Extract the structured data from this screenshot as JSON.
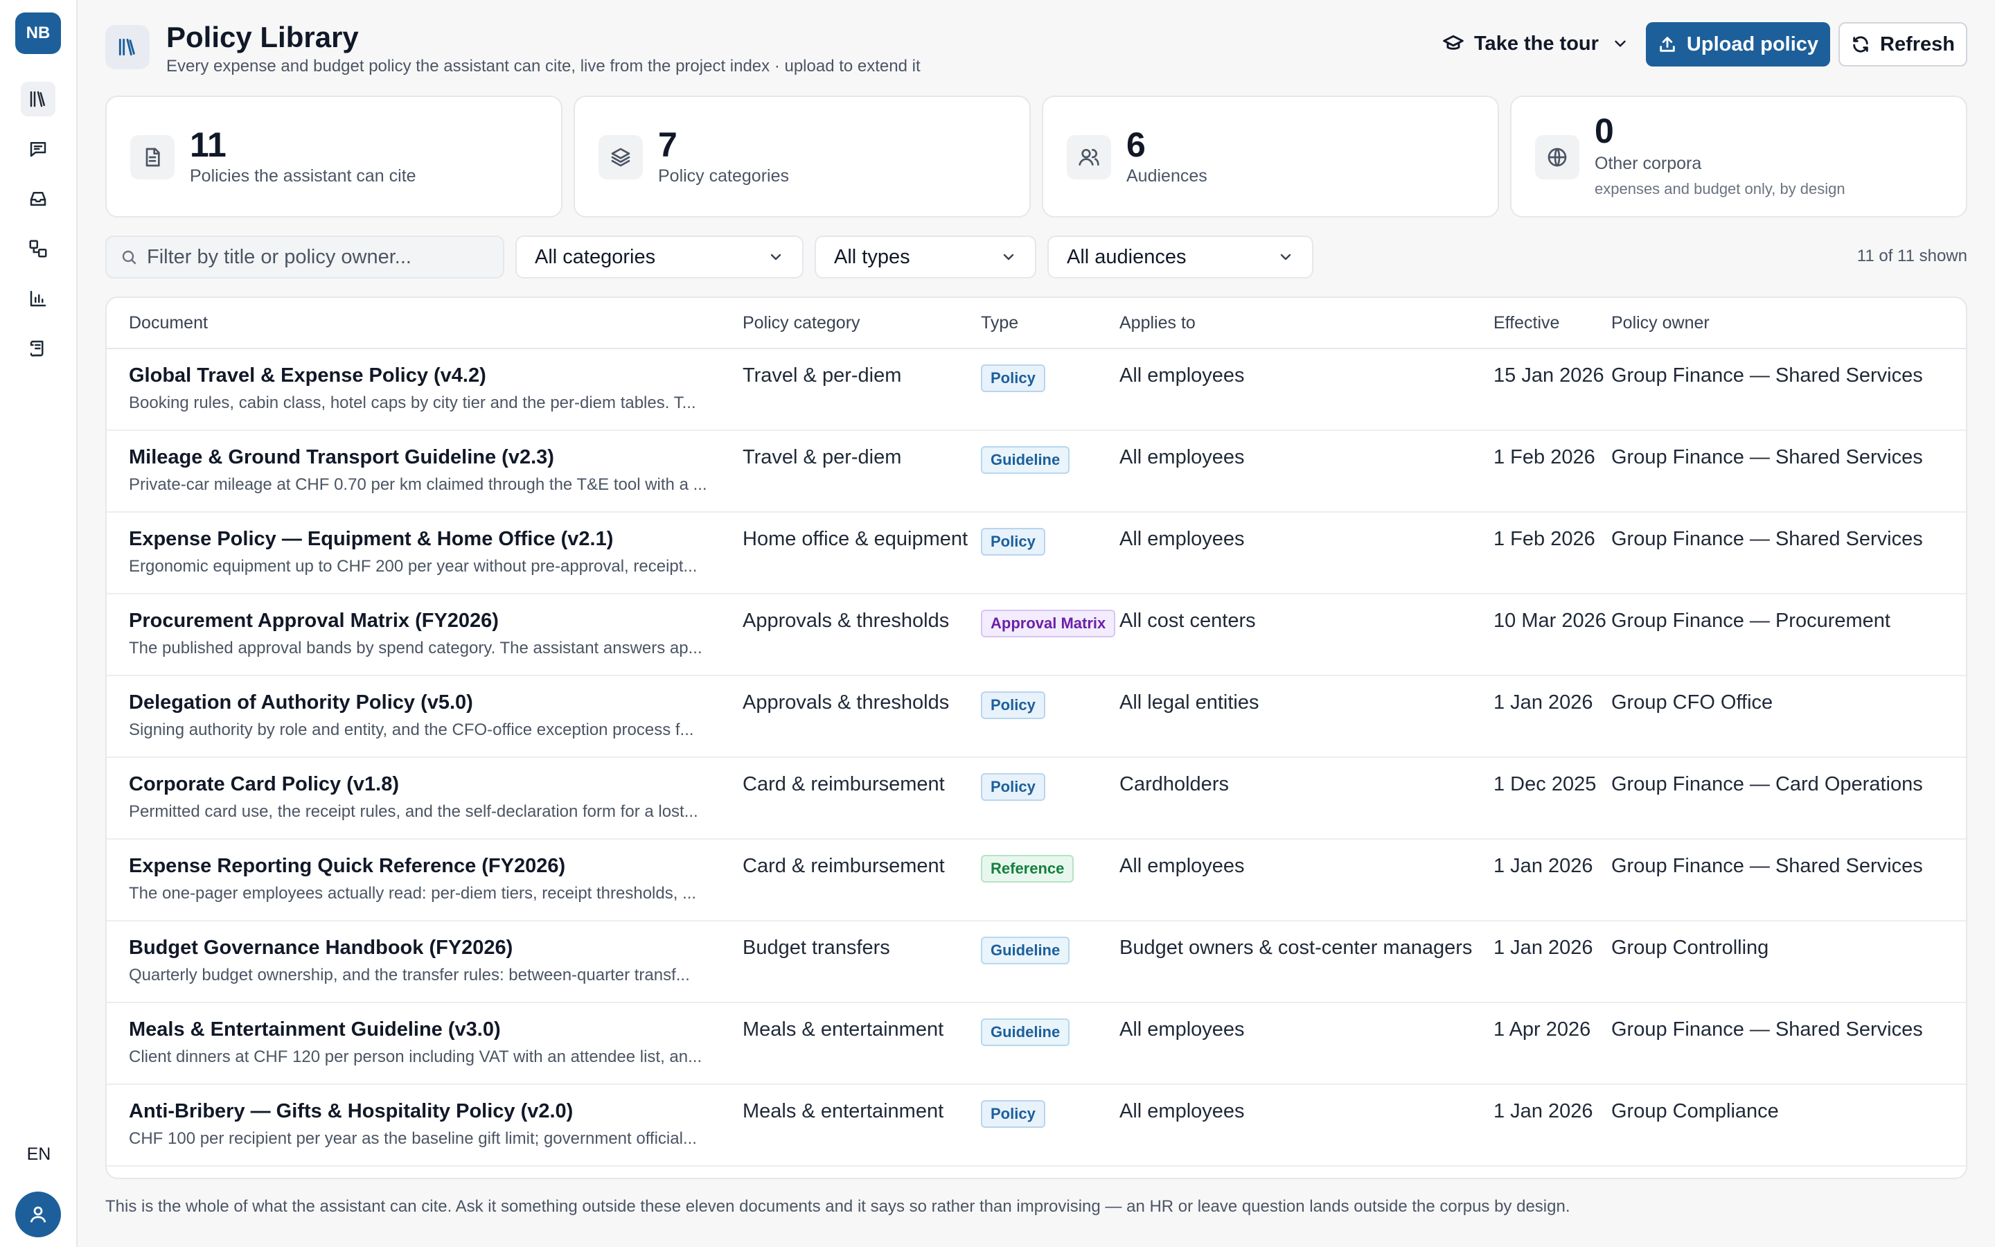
{
  "sidebar": {
    "logo": "NB",
    "nav": [
      {
        "icon": "library-icon",
        "active": true
      },
      {
        "icon": "chat-icon",
        "active": false
      },
      {
        "icon": "inbox-icon",
        "active": false
      },
      {
        "icon": "workflow-icon",
        "active": false
      },
      {
        "icon": "bar-chart-icon",
        "active": false
      },
      {
        "icon": "scroll-icon",
        "active": false
      }
    ],
    "language": "EN"
  },
  "header": {
    "title": "Policy Library",
    "subtitle": "Every expense and budget policy the assistant can cite, live from the project index · upload to extend it",
    "tour_label": "Take the tour",
    "upload_label": "Upload policy",
    "refresh_label": "Refresh"
  },
  "stats": [
    {
      "value": "11",
      "label": "Policies the assistant can cite"
    },
    {
      "value": "7",
      "label": "Policy categories"
    },
    {
      "value": "6",
      "label": "Audiences"
    },
    {
      "value": "0",
      "label": "Other corpora",
      "note": "expenses and budget only, by design"
    }
  ],
  "filters": {
    "search_placeholder": "Filter by title or policy owner...",
    "category": "All categories",
    "type": "All types",
    "audience": "All audiences",
    "shown": "11 of 11 shown"
  },
  "table": {
    "columns": [
      "Document",
      "Policy category",
      "Type",
      "Applies to",
      "Effective",
      "Policy owner"
    ],
    "rows": [
      {
        "title": "Global Travel & Expense Policy (v4.2)",
        "desc": "Booking rules, cabin class, hotel caps by city tier and the per-diem tables. T...",
        "category": "Travel & per-diem",
        "type": "Policy",
        "applies": "All employees",
        "effective": "15 Jan 2026",
        "owner": "Group Finance — Shared Services"
      },
      {
        "title": "Mileage & Ground Transport Guideline (v2.3)",
        "desc": "Private-car mileage at CHF 0.70 per km claimed through the T&E tool with a ...",
        "category": "Travel & per-diem",
        "type": "Guideline",
        "applies": "All employees",
        "effective": "1 Feb 2026",
        "owner": "Group Finance — Shared Services"
      },
      {
        "title": "Expense Policy — Equipment & Home Office (v2.1)",
        "desc": "Ergonomic equipment up to CHF 200 per year without pre-approval, receipt...",
        "category": "Home office & equipment",
        "type": "Policy",
        "applies": "All employees",
        "effective": "1 Feb 2026",
        "owner": "Group Finance — Shared Services"
      },
      {
        "title": "Procurement Approval Matrix (FY2026)",
        "desc": "The published approval bands by spend category. The assistant answers ap...",
        "category": "Approvals & thresholds",
        "type": "Approval Matrix",
        "applies": "All cost centers",
        "effective": "10 Mar 2026",
        "owner": "Group Finance — Procurement"
      },
      {
        "title": "Delegation of Authority Policy (v5.0)",
        "desc": "Signing authority by role and entity, and the CFO-office exception process f...",
        "category": "Approvals & thresholds",
        "type": "Policy",
        "applies": "All legal entities",
        "effective": "1 Jan 2026",
        "owner": "Group CFO Office"
      },
      {
        "title": "Corporate Card Policy (v1.8)",
        "desc": "Permitted card use, the receipt rules, and the self-declaration form for a lost...",
        "category": "Card & reimbursement",
        "type": "Policy",
        "applies": "Cardholders",
        "effective": "1 Dec 2025",
        "owner": "Group Finance — Card Operations"
      },
      {
        "title": "Expense Reporting Quick Reference (FY2026)",
        "desc": "The one-pager employees actually read: per-diem tiers, receipt thresholds, ...",
        "category": "Card & reimbursement",
        "type": "Reference",
        "applies": "All employees",
        "effective": "1 Jan 2026",
        "owner": "Group Finance — Shared Services"
      },
      {
        "title": "Budget Governance Handbook (FY2026)",
        "desc": "Quarterly budget ownership, and the transfer rules: between-quarter transf...",
        "category": "Budget transfers",
        "type": "Guideline",
        "applies": "Budget owners & cost-center managers",
        "effective": "1 Jan 2026",
        "owner": "Group Controlling"
      },
      {
        "title": "Meals & Entertainment Guideline (v3.0)",
        "desc": "Client dinners at CHF 120 per person including VAT with an attendee list, an...",
        "category": "Meals & entertainment",
        "type": "Guideline",
        "applies": "All employees",
        "effective": "1 Apr 2026",
        "owner": "Group Finance — Shared Services"
      },
      {
        "title": "Anti-Bribery — Gifts & Hospitality Policy (v2.0)",
        "desc": "CHF 100 per recipient per year as the baseline gift limit; government official...",
        "category": "Meals & entertainment",
        "type": "Policy",
        "applies": "All employees",
        "effective": "1 Jan 2026",
        "owner": "Group Compliance"
      }
    ]
  },
  "footer_note": "This is the whole of what the assistant can cite. Ask it something outside these eleven documents and it says so rather than improvising — an HR or leave question lands outside the corpus by design.",
  "colors": {
    "accent": "#1d5f9a",
    "background": "#f7f7f8"
  }
}
